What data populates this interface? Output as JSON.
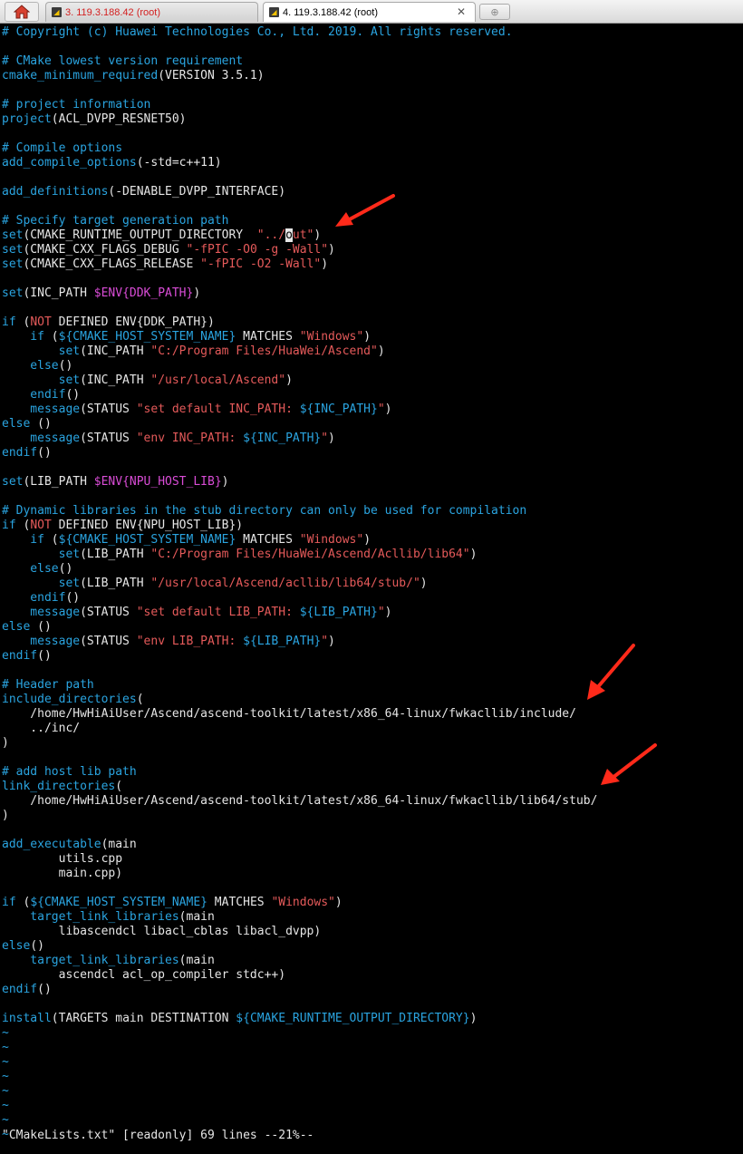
{
  "tabs": [
    {
      "label": "3. 119.3.188.42 (root)"
    },
    {
      "label": "4. 119.3.188.42 (root)"
    }
  ],
  "icons": {
    "home": "home-icon",
    "session": "terminal-session-icon",
    "close": "close-icon",
    "new_tab": "new-tab-icon"
  },
  "editor": {
    "lines": [
      [
        [
          "# Copyright (c) Huawei Technologies Co., Ltd. 2019. All rights reserved.",
          "cmt"
        ]
      ],
      [
        [
          "",
          ""
        ]
      ],
      [
        [
          "# CMake lowest version requirement",
          "cmt"
        ]
      ],
      [
        [
          "cmake_minimum_required",
          "kw"
        ],
        [
          "(VERSION 3.5.1)",
          ""
        ]
      ],
      [
        [
          "",
          ""
        ]
      ],
      [
        [
          "# project information",
          "cmt"
        ]
      ],
      [
        [
          "project",
          "kw"
        ],
        [
          "(ACL_DVPP_RESNET50)",
          ""
        ]
      ],
      [
        [
          "",
          ""
        ]
      ],
      [
        [
          "# Compile options",
          "cmt"
        ]
      ],
      [
        [
          "add_compile_options",
          "kw"
        ],
        [
          "(-std=c++11)",
          ""
        ]
      ],
      [
        [
          "",
          ""
        ]
      ],
      [
        [
          "add_definitions",
          "kw"
        ],
        [
          "(-DENABLE_DVPP_INTERFACE)",
          ""
        ]
      ],
      [
        [
          "",
          ""
        ]
      ],
      [
        [
          "# Specify target generation path",
          "cmt"
        ]
      ],
      [
        [
          "set",
          "kw"
        ],
        [
          "(CMAKE_RUNTIME_OUTPUT_DIRECTORY  ",
          ""
        ],
        [
          "\"../",
          "str"
        ],
        [
          "o",
          "cursor"
        ],
        [
          "ut\"",
          "str"
        ],
        [
          ")",
          ""
        ]
      ],
      [
        [
          "set",
          "kw"
        ],
        [
          "(CMAKE_CXX_FLAGS_DEBUG ",
          ""
        ],
        [
          "\"-fPIC -O0 -g -Wall\"",
          "str"
        ],
        [
          ")",
          ""
        ]
      ],
      [
        [
          "set",
          "kw"
        ],
        [
          "(CMAKE_CXX_FLAGS_RELEASE ",
          ""
        ],
        [
          "\"-fPIC -O2 -Wall\"",
          "str"
        ],
        [
          ")",
          ""
        ]
      ],
      [
        [
          "",
          ""
        ]
      ],
      [
        [
          "set",
          "kw"
        ],
        [
          "(INC_PATH ",
          ""
        ],
        [
          "$ENV{DDK_PATH}",
          "env"
        ],
        [
          ")",
          ""
        ]
      ],
      [
        [
          "",
          ""
        ]
      ],
      [
        [
          "if",
          "kw"
        ],
        [
          " (",
          ""
        ],
        [
          "NOT",
          "str"
        ],
        [
          " DEFINED ENV{DDK_PATH})",
          ""
        ]
      ],
      [
        [
          "    if",
          "kw"
        ],
        [
          " (",
          ""
        ],
        [
          "${CMAKE_HOST_SYSTEM_NAME}",
          "var"
        ],
        [
          " MATCHES ",
          ""
        ],
        [
          "\"Windows\"",
          "str"
        ],
        [
          ")",
          ""
        ]
      ],
      [
        [
          "        set",
          "kw"
        ],
        [
          "(INC_PATH ",
          ""
        ],
        [
          "\"C:/Program Files/HuaWei/Ascend\"",
          "str"
        ],
        [
          ")",
          ""
        ]
      ],
      [
        [
          "    else",
          "kw"
        ],
        [
          "()",
          ""
        ]
      ],
      [
        [
          "        set",
          "kw"
        ],
        [
          "(INC_PATH ",
          ""
        ],
        [
          "\"/usr/local/Ascend\"",
          "str"
        ],
        [
          ")",
          ""
        ]
      ],
      [
        [
          "    endif",
          "kw"
        ],
        [
          "()",
          ""
        ]
      ],
      [
        [
          "    message",
          "kw"
        ],
        [
          "(STATUS ",
          ""
        ],
        [
          "\"set default INC_PATH: ",
          "str"
        ],
        [
          "${INC_PATH}",
          "var"
        ],
        [
          "\"",
          "str"
        ],
        [
          ")",
          ""
        ]
      ],
      [
        [
          "else",
          "kw"
        ],
        [
          " ()",
          ""
        ]
      ],
      [
        [
          "    message",
          "kw"
        ],
        [
          "(STATUS ",
          ""
        ],
        [
          "\"env INC_PATH: ",
          "str"
        ],
        [
          "${INC_PATH}",
          "var"
        ],
        [
          "\"",
          "str"
        ],
        [
          ")",
          ""
        ]
      ],
      [
        [
          "endif",
          "kw"
        ],
        [
          "()",
          ""
        ]
      ],
      [
        [
          "",
          ""
        ]
      ],
      [
        [
          "set",
          "kw"
        ],
        [
          "(LIB_PATH ",
          ""
        ],
        [
          "$ENV{NPU_HOST_LIB}",
          "env"
        ],
        [
          ")",
          ""
        ]
      ],
      [
        [
          "",
          ""
        ]
      ],
      [
        [
          "# Dynamic libraries in the stub directory can only be used for compilation",
          "cmt"
        ]
      ],
      [
        [
          "if",
          "kw"
        ],
        [
          " (",
          ""
        ],
        [
          "NOT",
          "str"
        ],
        [
          " DEFINED ENV{NPU_HOST_LIB})",
          ""
        ]
      ],
      [
        [
          "    if",
          "kw"
        ],
        [
          " (",
          ""
        ],
        [
          "${CMAKE_HOST_SYSTEM_NAME}",
          "var"
        ],
        [
          " MATCHES ",
          ""
        ],
        [
          "\"Windows\"",
          "str"
        ],
        [
          ")",
          ""
        ]
      ],
      [
        [
          "        set",
          "kw"
        ],
        [
          "(LIB_PATH ",
          ""
        ],
        [
          "\"C:/Program Files/HuaWei/Ascend/Acllib/lib64\"",
          "str"
        ],
        [
          ")",
          ""
        ]
      ],
      [
        [
          "    else",
          "kw"
        ],
        [
          "()",
          ""
        ]
      ],
      [
        [
          "        set",
          "kw"
        ],
        [
          "(LIB_PATH ",
          ""
        ],
        [
          "\"/usr/local/Ascend/acllib/lib64/stub/\"",
          "str"
        ],
        [
          ")",
          ""
        ]
      ],
      [
        [
          "    endif",
          "kw"
        ],
        [
          "()",
          ""
        ]
      ],
      [
        [
          "    message",
          "kw"
        ],
        [
          "(STATUS ",
          ""
        ],
        [
          "\"set default LIB_PATH: ",
          "str"
        ],
        [
          "${LIB_PATH}",
          "var"
        ],
        [
          "\"",
          "str"
        ],
        [
          ")",
          ""
        ]
      ],
      [
        [
          "else",
          "kw"
        ],
        [
          " ()",
          ""
        ]
      ],
      [
        [
          "    message",
          "kw"
        ],
        [
          "(STATUS ",
          ""
        ],
        [
          "\"env LIB_PATH: ",
          "str"
        ],
        [
          "${LIB_PATH}",
          "var"
        ],
        [
          "\"",
          "str"
        ],
        [
          ")",
          ""
        ]
      ],
      [
        [
          "endif",
          "kw"
        ],
        [
          "()",
          ""
        ]
      ],
      [
        [
          "",
          ""
        ]
      ],
      [
        [
          "# Header path",
          "cmt"
        ]
      ],
      [
        [
          "include_directories",
          "kw"
        ],
        [
          "(",
          ""
        ]
      ],
      [
        [
          "    /home/HwHiAiUser/Ascend/ascend-toolkit/latest/x86_64-linux/fwkacllib/include/",
          ""
        ]
      ],
      [
        [
          "    ../inc/",
          ""
        ]
      ],
      [
        [
          ")",
          ""
        ]
      ],
      [
        [
          "",
          ""
        ]
      ],
      [
        [
          "# add host lib path",
          "cmt"
        ]
      ],
      [
        [
          "link_directories",
          "kw"
        ],
        [
          "(",
          ""
        ]
      ],
      [
        [
          "    /home/HwHiAiUser/Ascend/ascend-toolkit/latest/x86_64-linux/fwkacllib/lib64/stub/",
          ""
        ]
      ],
      [
        [
          ")",
          ""
        ]
      ],
      [
        [
          "",
          ""
        ]
      ],
      [
        [
          "add_executable",
          "kw"
        ],
        [
          "(main",
          ""
        ]
      ],
      [
        [
          "        utils.cpp",
          ""
        ]
      ],
      [
        [
          "        main.cpp)",
          ""
        ]
      ],
      [
        [
          "",
          ""
        ]
      ],
      [
        [
          "if",
          "kw"
        ],
        [
          " (",
          ""
        ],
        [
          "${CMAKE_HOST_SYSTEM_NAME}",
          "var"
        ],
        [
          " MATCHES ",
          ""
        ],
        [
          "\"Windows\"",
          "str"
        ],
        [
          ")",
          ""
        ]
      ],
      [
        [
          "    target_link_libraries",
          "kw"
        ],
        [
          "(main",
          ""
        ]
      ],
      [
        [
          "        libascendcl libacl_cblas libacl_dvpp)",
          ""
        ]
      ],
      [
        [
          "else",
          "kw"
        ],
        [
          "()",
          ""
        ]
      ],
      [
        [
          "    target_link_libraries",
          "kw"
        ],
        [
          "(main",
          ""
        ]
      ],
      [
        [
          "        ascendcl acl_op_compiler stdc++)",
          ""
        ]
      ],
      [
        [
          "endif",
          "kw"
        ],
        [
          "()",
          ""
        ]
      ],
      [
        [
          "",
          ""
        ]
      ],
      [
        [
          "install",
          "kw"
        ],
        [
          "(TARGETS main DESTINATION ",
          ""
        ],
        [
          "${CMAKE_RUNTIME_OUTPUT_DIRECTORY}",
          "var"
        ],
        [
          ")",
          ""
        ]
      ],
      [
        [
          "~",
          "tilde"
        ]
      ],
      [
        [
          "~",
          "tilde"
        ]
      ],
      [
        [
          "~",
          "tilde"
        ]
      ],
      [
        [
          "~",
          "tilde"
        ]
      ],
      [
        [
          "~",
          "tilde"
        ]
      ],
      [
        [
          "~",
          "tilde"
        ]
      ],
      [
        [
          "~",
          "tilde"
        ]
      ],
      [
        [
          "~",
          "tilde"
        ]
      ]
    ],
    "status": "\"CMakeLists.txt\" [readonly] 69 lines --21%--"
  },
  "annotations": [
    {
      "name": "annotation-arrow"
    },
    {
      "name": "annotation-arrow"
    },
    {
      "name": "annotation-arrow"
    }
  ],
  "colors": {
    "background": "#000000",
    "text": "#e6e6e6",
    "keyword": "#2aa4e0",
    "string": "#e55a5a",
    "env": "#d94cd6",
    "arrow": "#ff2a1a"
  }
}
